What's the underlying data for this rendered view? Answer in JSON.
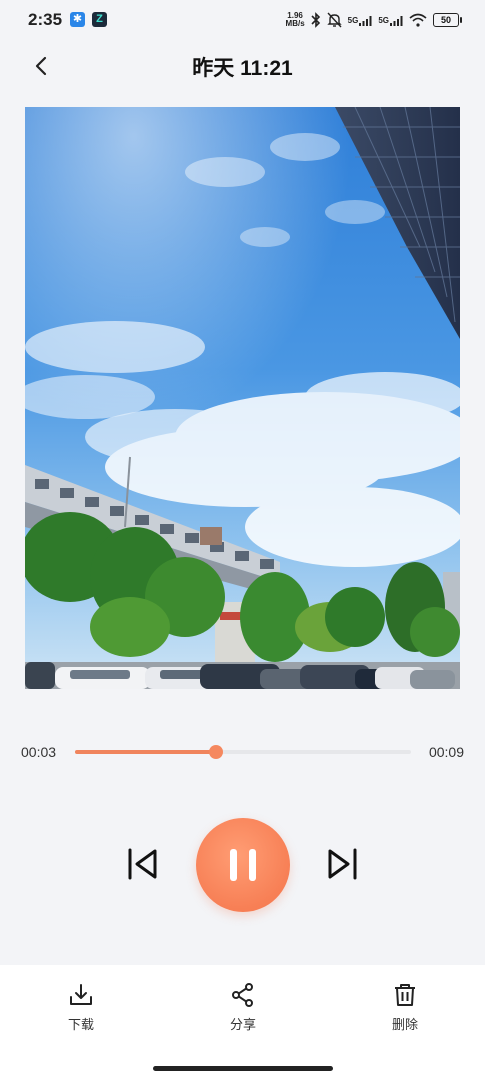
{
  "status_bar": {
    "time": "2:35",
    "net_speed_value": "1.96",
    "net_speed_unit": "MB/s",
    "sig1": "5G",
    "sig2": "5G",
    "battery": "50"
  },
  "header": {
    "title": "昨天 11:21"
  },
  "player": {
    "current_time": "00:03",
    "duration": "00:09",
    "progress": 0.42
  },
  "toolbar": {
    "download_label": "下载",
    "share_label": "分享",
    "delete_label": "删除"
  },
  "colors": {
    "accent": "#f5845c",
    "track": "#e6e7ea",
    "background": "#f3f4f7"
  }
}
